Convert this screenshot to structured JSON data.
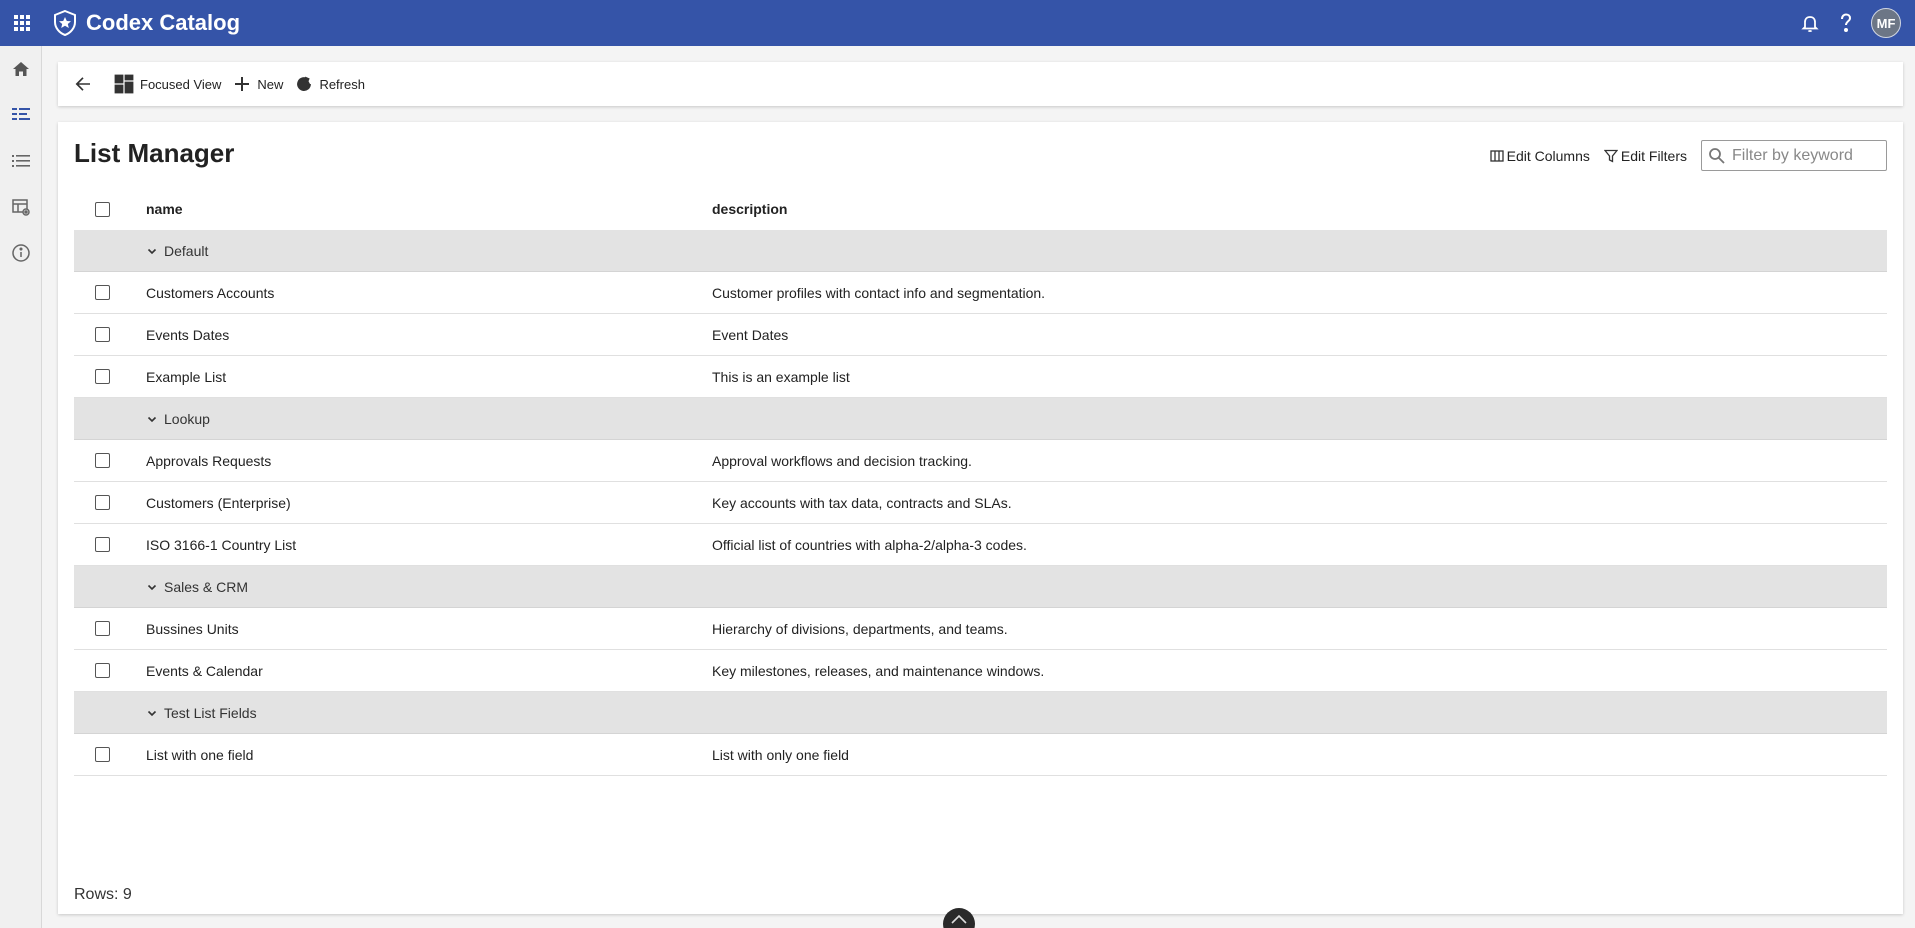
{
  "app": {
    "title": "Codex Catalog",
    "user_initials": "MF"
  },
  "toolbar": {
    "focused_view_label": "Focused View",
    "new_label": "New",
    "refresh_label": "Refresh"
  },
  "page": {
    "title": "List Manager",
    "edit_columns_label": "Edit Columns",
    "edit_filters_label": "Edit Filters",
    "search_placeholder": "Filter by keyword"
  },
  "table": {
    "columns": [
      "name",
      "description"
    ],
    "groups": [
      {
        "label": "Default",
        "rows": [
          {
            "name": "Customers Accounts",
            "description": "Customer profiles with contact info and segmentation."
          },
          {
            "name": "Events Dates",
            "description": "Event Dates"
          },
          {
            "name": "Example List",
            "description": "This is an example list"
          }
        ]
      },
      {
        "label": "Lookup",
        "rows": [
          {
            "name": "Approvals Requests",
            "description": "Approval workflows and decision tracking."
          },
          {
            "name": "Customers (Enterprise)",
            "description": "Key accounts with tax data, contracts and SLAs."
          },
          {
            "name": "ISO 3166-1 Country List",
            "description": "Official list of countries with alpha-2/alpha-3 codes."
          }
        ]
      },
      {
        "label": "Sales & CRM",
        "rows": [
          {
            "name": "Bussines Units",
            "description": "Hierarchy of divisions, departments, and teams."
          },
          {
            "name": "Events & Calendar",
            "description": "Key milestones, releases, and maintenance windows."
          }
        ]
      },
      {
        "label": "Test List Fields",
        "rows": [
          {
            "name": "List with one field",
            "description": "List with only one field"
          }
        ]
      }
    ]
  },
  "footer": {
    "rows_label": "Rows: 9"
  },
  "icons": {
    "apps": "apps-grid-icon",
    "logo": "shield-star-logo-icon",
    "bell": "bell-icon",
    "help": "help-icon",
    "home": "home-icon",
    "list_manager": "list-manager-icon",
    "list": "list-icon",
    "table_settings": "table-settings-icon",
    "info": "info-icon",
    "back": "arrow-left-icon",
    "focused": "focused-view-icon",
    "new": "plus-icon",
    "refresh": "refresh-icon",
    "columns": "columns-icon",
    "filter": "filter-icon",
    "search": "search-icon",
    "chevron": "chevron-down-icon"
  },
  "colors": {
    "header_bg": "#3554a8",
    "group_bg": "#e3e3e3"
  }
}
